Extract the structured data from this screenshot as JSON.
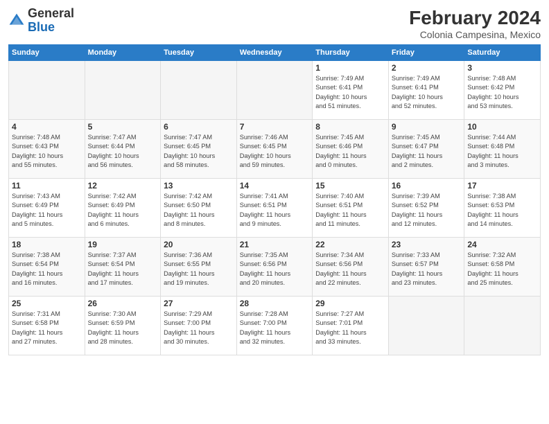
{
  "logo": {
    "general": "General",
    "blue": "Blue"
  },
  "title": "February 2024",
  "subtitle": "Colonia Campesina, Mexico",
  "days_of_week": [
    "Sunday",
    "Monday",
    "Tuesday",
    "Wednesday",
    "Thursday",
    "Friday",
    "Saturday"
  ],
  "weeks": [
    [
      {
        "day": "",
        "info": "",
        "empty": true
      },
      {
        "day": "",
        "info": "",
        "empty": true
      },
      {
        "day": "",
        "info": "",
        "empty": true
      },
      {
        "day": "",
        "info": "",
        "empty": true
      },
      {
        "day": "1",
        "info": "Sunrise: 7:49 AM\nSunset: 6:41 PM\nDaylight: 10 hours\nand 51 minutes.",
        "empty": false
      },
      {
        "day": "2",
        "info": "Sunrise: 7:49 AM\nSunset: 6:41 PM\nDaylight: 10 hours\nand 52 minutes.",
        "empty": false
      },
      {
        "day": "3",
        "info": "Sunrise: 7:48 AM\nSunset: 6:42 PM\nDaylight: 10 hours\nand 53 minutes.",
        "empty": false
      }
    ],
    [
      {
        "day": "4",
        "info": "Sunrise: 7:48 AM\nSunset: 6:43 PM\nDaylight: 10 hours\nand 55 minutes.",
        "empty": false
      },
      {
        "day": "5",
        "info": "Sunrise: 7:47 AM\nSunset: 6:44 PM\nDaylight: 10 hours\nand 56 minutes.",
        "empty": false
      },
      {
        "day": "6",
        "info": "Sunrise: 7:47 AM\nSunset: 6:45 PM\nDaylight: 10 hours\nand 58 minutes.",
        "empty": false
      },
      {
        "day": "7",
        "info": "Sunrise: 7:46 AM\nSunset: 6:45 PM\nDaylight: 10 hours\nand 59 minutes.",
        "empty": false
      },
      {
        "day": "8",
        "info": "Sunrise: 7:45 AM\nSunset: 6:46 PM\nDaylight: 11 hours\nand 0 minutes.",
        "empty": false
      },
      {
        "day": "9",
        "info": "Sunrise: 7:45 AM\nSunset: 6:47 PM\nDaylight: 11 hours\nand 2 minutes.",
        "empty": false
      },
      {
        "day": "10",
        "info": "Sunrise: 7:44 AM\nSunset: 6:48 PM\nDaylight: 11 hours\nand 3 minutes.",
        "empty": false
      }
    ],
    [
      {
        "day": "11",
        "info": "Sunrise: 7:43 AM\nSunset: 6:49 PM\nDaylight: 11 hours\nand 5 minutes.",
        "empty": false
      },
      {
        "day": "12",
        "info": "Sunrise: 7:42 AM\nSunset: 6:49 PM\nDaylight: 11 hours\nand 6 minutes.",
        "empty": false
      },
      {
        "day": "13",
        "info": "Sunrise: 7:42 AM\nSunset: 6:50 PM\nDaylight: 11 hours\nand 8 minutes.",
        "empty": false
      },
      {
        "day": "14",
        "info": "Sunrise: 7:41 AM\nSunset: 6:51 PM\nDaylight: 11 hours\nand 9 minutes.",
        "empty": false
      },
      {
        "day": "15",
        "info": "Sunrise: 7:40 AM\nSunset: 6:51 PM\nDaylight: 11 hours\nand 11 minutes.",
        "empty": false
      },
      {
        "day": "16",
        "info": "Sunrise: 7:39 AM\nSunset: 6:52 PM\nDaylight: 11 hours\nand 12 minutes.",
        "empty": false
      },
      {
        "day": "17",
        "info": "Sunrise: 7:38 AM\nSunset: 6:53 PM\nDaylight: 11 hours\nand 14 minutes.",
        "empty": false
      }
    ],
    [
      {
        "day": "18",
        "info": "Sunrise: 7:38 AM\nSunset: 6:54 PM\nDaylight: 11 hours\nand 16 minutes.",
        "empty": false
      },
      {
        "day": "19",
        "info": "Sunrise: 7:37 AM\nSunset: 6:54 PM\nDaylight: 11 hours\nand 17 minutes.",
        "empty": false
      },
      {
        "day": "20",
        "info": "Sunrise: 7:36 AM\nSunset: 6:55 PM\nDaylight: 11 hours\nand 19 minutes.",
        "empty": false
      },
      {
        "day": "21",
        "info": "Sunrise: 7:35 AM\nSunset: 6:56 PM\nDaylight: 11 hours\nand 20 minutes.",
        "empty": false
      },
      {
        "day": "22",
        "info": "Sunrise: 7:34 AM\nSunset: 6:56 PM\nDaylight: 11 hours\nand 22 minutes.",
        "empty": false
      },
      {
        "day": "23",
        "info": "Sunrise: 7:33 AM\nSunset: 6:57 PM\nDaylight: 11 hours\nand 23 minutes.",
        "empty": false
      },
      {
        "day": "24",
        "info": "Sunrise: 7:32 AM\nSunset: 6:58 PM\nDaylight: 11 hours\nand 25 minutes.",
        "empty": false
      }
    ],
    [
      {
        "day": "25",
        "info": "Sunrise: 7:31 AM\nSunset: 6:58 PM\nDaylight: 11 hours\nand 27 minutes.",
        "empty": false
      },
      {
        "day": "26",
        "info": "Sunrise: 7:30 AM\nSunset: 6:59 PM\nDaylight: 11 hours\nand 28 minutes.",
        "empty": false
      },
      {
        "day": "27",
        "info": "Sunrise: 7:29 AM\nSunset: 7:00 PM\nDaylight: 11 hours\nand 30 minutes.",
        "empty": false
      },
      {
        "day": "28",
        "info": "Sunrise: 7:28 AM\nSunset: 7:00 PM\nDaylight: 11 hours\nand 32 minutes.",
        "empty": false
      },
      {
        "day": "29",
        "info": "Sunrise: 7:27 AM\nSunset: 7:01 PM\nDaylight: 11 hours\nand 33 minutes.",
        "empty": false
      },
      {
        "day": "",
        "info": "",
        "empty": true
      },
      {
        "day": "",
        "info": "",
        "empty": true
      }
    ]
  ]
}
